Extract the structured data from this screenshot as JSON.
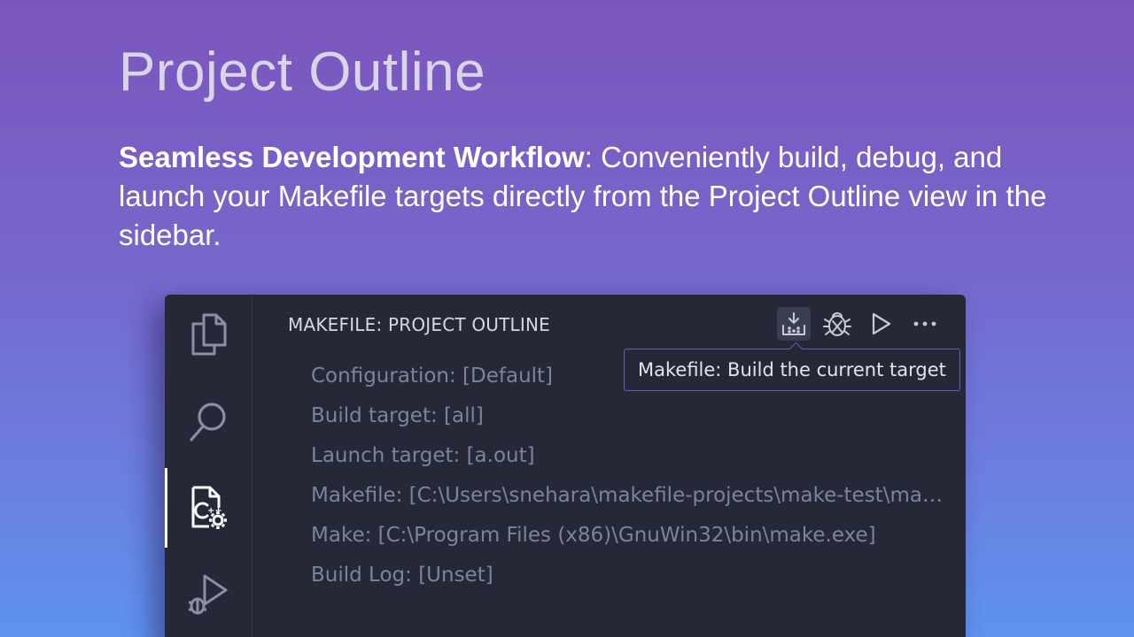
{
  "slide": {
    "title": "Project Outline",
    "description_bold": "Seamless Development Workflow",
    "description_rest": ": Conveniently build, debug, and launch your Makefile targets directly from the Project Outline view in the sidebar."
  },
  "activity_bar": {
    "items": [
      {
        "icon": "files-icon",
        "active": false
      },
      {
        "icon": "search-icon",
        "active": false
      },
      {
        "icon": "makefile-tools-icon",
        "active": true
      },
      {
        "icon": "run-debug-icon",
        "active": false
      }
    ]
  },
  "panel": {
    "title": "MAKEFILE: PROJECT OUTLINE",
    "actions": [
      {
        "icon": "build-icon",
        "hovered": true
      },
      {
        "icon": "debug-icon",
        "hovered": false
      },
      {
        "icon": "run-icon",
        "hovered": false
      },
      {
        "icon": "more-icon",
        "hovered": false
      }
    ],
    "tooltip": "Makefile: Build the current target",
    "items": [
      "Configuration: [Default]",
      "Build target: [all]",
      "Launch target: [a.out]",
      "Makefile: [C:\\Users\\snehara\\makefile-projects\\make-test\\makefile]",
      "Make: [C:\\Program Files (x86)\\GnuWin32\\bin\\make.exe]",
      "Build Log: [Unset]"
    ]
  },
  "colors": {
    "background_top": "#7b55bd",
    "background_bottom": "#5d93f0",
    "editor_bg": "#252836",
    "item_text": "#7b849e",
    "tooltip_border": "#6c5cb8"
  }
}
